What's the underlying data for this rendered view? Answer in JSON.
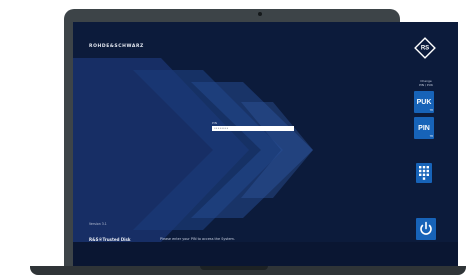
{
  "brand": {
    "logo_text": "ROHDE&SCHWARZ"
  },
  "login": {
    "caption": "PIN",
    "masked_value": "••••••••",
    "hint": "Please enter your PIN to access the System."
  },
  "side_panel": {
    "heading_line1": "Change",
    "heading_line2": "PIN / PUK",
    "puk_button": {
      "label": "PUK",
      "sub": "TB"
    },
    "pin_button": {
      "label": "PIN",
      "sub": "TB"
    },
    "keypad_icon": "keypad-icon",
    "power_icon": "power-icon"
  },
  "footer": {
    "version": "Version 3.1",
    "product": "R&S®Trusted Disk"
  },
  "colors": {
    "screen_bg": "#0c1b3b",
    "button_blue": "#1763b8",
    "laptop_frame": "#3d4448"
  }
}
